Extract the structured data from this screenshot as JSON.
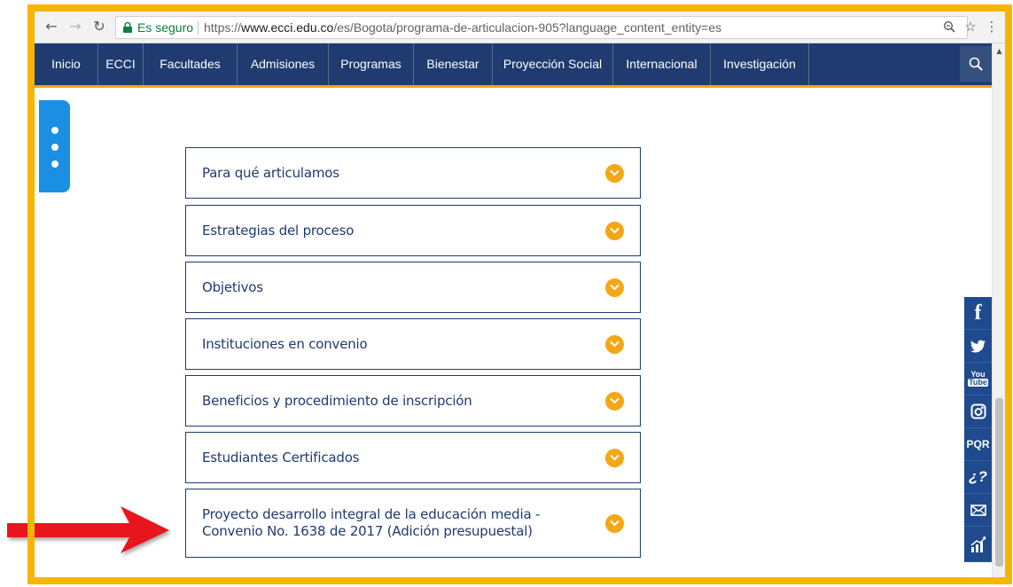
{
  "browser": {
    "secure_label": "Es seguro",
    "url_prefix": "https://",
    "url_host": "www.ecci.edu.co",
    "url_path": "/es/Bogota/programa-de-articulacion-905?language_content_entity=es"
  },
  "nav": {
    "items": [
      "Inicio",
      "ECCI",
      "Facultades",
      "Admisiones",
      "Programas",
      "Bienestar",
      "Proyección Social",
      "Internacional",
      "Investigación"
    ]
  },
  "accordion": {
    "items": [
      "Para qué articulamos",
      "Estrategias del proceso",
      "Objetivos",
      "Instituciones en convenio",
      "Beneficios y procedimiento de inscripción",
      "Estudiantes Certificados",
      "Proyecto desarrollo integral de la educación media - Convenio No. 1638 de 2017 (Adición presupuestal)"
    ]
  },
  "social": {
    "pqr_label": "PQR",
    "help_label": "¿?"
  },
  "colors": {
    "nav_bg": "#1f3b6f",
    "accent_yellow": "#f4a716",
    "frame_yellow": "#f7b500",
    "menu_tab": "#1a8fe3",
    "arrow_red": "#e8141b"
  }
}
